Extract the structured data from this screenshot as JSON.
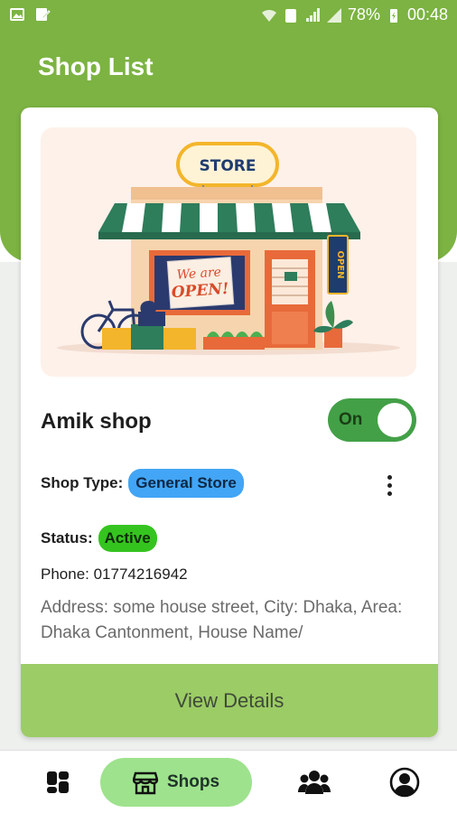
{
  "status_bar": {
    "battery": "78%",
    "time": "00:48"
  },
  "header": {
    "title": "Shop List"
  },
  "illustration": {
    "store_sign": "STORE",
    "window_sign_line1": "We are",
    "window_sign_line2": "OPEN!",
    "open_sign": "OPEN"
  },
  "shop": {
    "name": "Amik shop",
    "toggle_label": "On",
    "type_label": "Shop Type:",
    "type_value": "General Store",
    "status_label": "Status:",
    "status_value": "Active",
    "phone": "Phone: 01774216942",
    "address": "Address: some house street, City: Dhaka, Area: Dhaka Cantonment, House Name/",
    "details_button": "View Details"
  },
  "bottom_nav": {
    "shops_label": "Shops"
  },
  "colors": {
    "primary": "#7cb342",
    "button": "#9ccc65",
    "toggle": "#43a047",
    "type_badge": "#42a5f5",
    "status_badge": "#35c41f",
    "nav_active": "#9ee28d"
  }
}
